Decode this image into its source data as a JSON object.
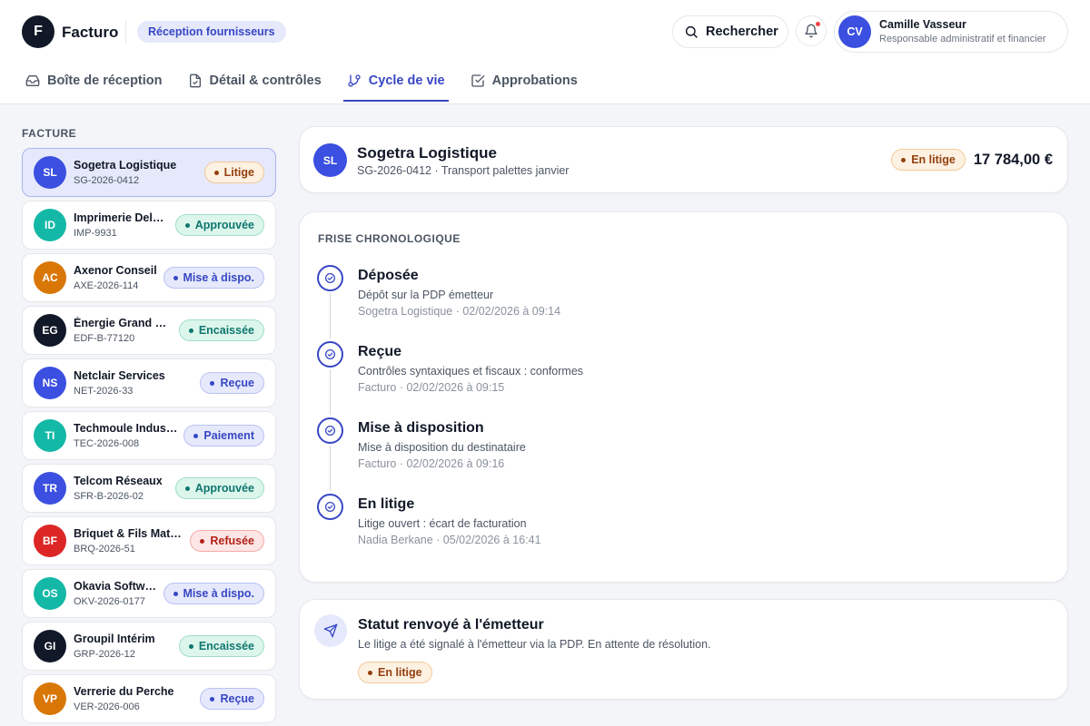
{
  "header": {
    "logo_letter": "F",
    "brand": "Facturo",
    "section": "Réception fournisseurs",
    "search_label": "Rechercher",
    "user": {
      "initials": "CV",
      "name": "Camille Vasseur",
      "role": "Responsable administratif et financier"
    }
  },
  "tabs": [
    {
      "label": "Boîte de réception",
      "icon": "inbox-icon"
    },
    {
      "label": "Détail & contrôles",
      "icon": "document-check-icon"
    },
    {
      "label": "Cycle de vie",
      "icon": "git-branch-icon",
      "active": true
    },
    {
      "label": "Approbations",
      "icon": "checkbox-icon"
    }
  ],
  "sidebar": {
    "title": "FACTURE",
    "invoices": [
      {
        "initials": "SL",
        "name": "Sogetra Logistique",
        "ref": "SG-2026-0412",
        "status": "Litige",
        "status_key": "litige",
        "avatar_color": "#3b4fe0",
        "selected": true
      },
      {
        "initials": "ID",
        "name": "Imprimerie Delacroix",
        "ref": "IMP-9931",
        "status": "Approuvée",
        "status_key": "approuvee",
        "avatar_color": "#14b8a6"
      },
      {
        "initials": "AC",
        "name": "Axenor Conseil",
        "ref": "AXE-2026-114",
        "status": "Mise à dispo.",
        "status_key": "dispo",
        "avatar_color": "#d97706"
      },
      {
        "initials": "EG",
        "name": "Énergie Grand Ouest",
        "ref": "EDF-B-77120",
        "status": "Encaissée",
        "status_key": "encaissee",
        "avatar_color": "#111827"
      },
      {
        "initials": "NS",
        "name": "Netclair Services",
        "ref": "NET-2026-33",
        "status": "Reçue",
        "status_key": "recue",
        "avatar_color": "#3b4fe0"
      },
      {
        "initials": "TI",
        "name": "Techmoule Industrie",
        "ref": "TEC-2026-008",
        "status": "Paiement",
        "status_key": "paiement",
        "avatar_color": "#14b8a6"
      },
      {
        "initials": "TR",
        "name": "Telcom Réseaux",
        "ref": "SFR-B-2026-02",
        "status": "Approuvée",
        "status_key": "approuvee",
        "avatar_color": "#3b4fe0"
      },
      {
        "initials": "BF",
        "name": "Briquet & Fils Matériaux",
        "ref": "BRQ-2026-51",
        "status": "Refusée",
        "status_key": "refusee",
        "avatar_color": "#dc2626"
      },
      {
        "initials": "OS",
        "name": "Okavia Software",
        "ref": "OKV-2026-0177",
        "status": "Mise à dispo.",
        "status_key": "dispo",
        "avatar_color": "#14b8a6"
      },
      {
        "initials": "GI",
        "name": "Groupil Intérim",
        "ref": "GRP-2026-12",
        "status": "Encaissée",
        "status_key": "encaissee",
        "avatar_color": "#111827"
      },
      {
        "initials": "VP",
        "name": "Verrerie du Perche",
        "ref": "VER-2026-006",
        "status": "Reçue",
        "status_key": "recue",
        "avatar_color": "#d97706"
      }
    ]
  },
  "invoice": {
    "initials": "SL",
    "supplier": "Sogetra Logistique",
    "subtitle": "SG-2026-0412 · Transport palettes janvier",
    "status": "En litige",
    "amount": "17 784,00 €"
  },
  "timeline": {
    "title": "FRISE CHRONOLOGIQUE",
    "steps": [
      {
        "name": "Déposée",
        "desc": "Dépôt sur la PDP émetteur",
        "meta": "Sogetra Logistique · 02/02/2026 à 09:14"
      },
      {
        "name": "Reçue",
        "desc": "Contrôles syntaxiques et fiscaux : conformes",
        "meta": "Facturo · 02/02/2026 à 09:15"
      },
      {
        "name": "Mise à disposition",
        "desc": "Mise à disposition du destinataire",
        "meta": "Facturo · 02/02/2026 à 09:16"
      },
      {
        "name": "En litige",
        "desc": "Litige ouvert : écart de facturation",
        "meta": "Nadia Berkane · 05/02/2026 à 16:41"
      }
    ]
  },
  "status_card": {
    "title": "Statut renvoyé à l'émetteur",
    "desc": "Le litige a été signalé à l'émetteur via la PDP. En attente de résolution.",
    "badge": "En litige"
  }
}
